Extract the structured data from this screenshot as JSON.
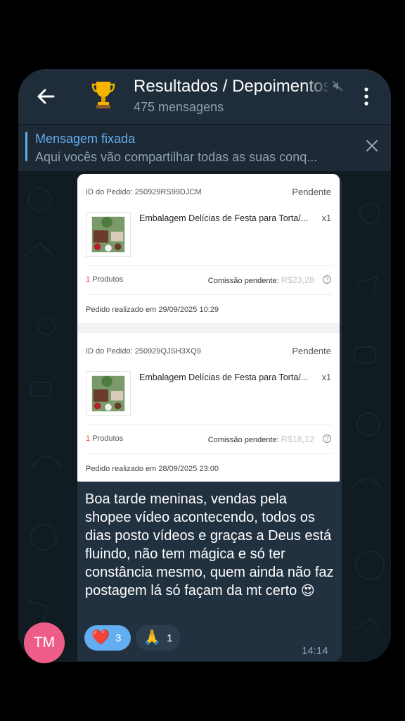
{
  "header": {
    "title": "Resultados / Depoimentos",
    "subtitle": "475 mensagens"
  },
  "pinned": {
    "label": "Mensagem fixada",
    "text": "Aqui vocês vão compartilhar todas as suas conq..."
  },
  "orders": [
    {
      "order_id": "ID do Pedido: 250929RS99DJCM",
      "status": "Pendente",
      "product": "Embalagem Delícias de Festa para Torta/...",
      "qty": "x1",
      "count_num": "1",
      "count_label": "Produtos",
      "commission_label": "Comissão pendente:",
      "commission_value": "R$23,28",
      "date": "Pedido realizado em 29/09/2025 10:29"
    },
    {
      "order_id": "ID do Pedido: 250929QJSH3XQ9",
      "status": "Pendente",
      "product": "Embalagem Delícias de Festa para Torta/...",
      "qty": "x1",
      "count_num": "1",
      "count_label": "Produtos",
      "commission_label": "Comissão pendente:",
      "commission_value": "R$18,12",
      "date": "Pedido realizado em 28/09/2025 23:00"
    }
  ],
  "message": {
    "text": "Boa tarde meninas, vendas pela shopee vídeo acontecendo, todos os dias posto  vídeos e graças a Deus está fluindo, não tem mágica e só ter constância mesmo, quem ainda não faz postagem lá só façam da mt certo",
    "emoji": "😍",
    "time": "14:14"
  },
  "reactions": [
    {
      "emoji": "❤️",
      "count": "3"
    },
    {
      "emoji": "🙏",
      "count": "1"
    }
  ],
  "avatar": {
    "initials": "TM"
  },
  "colors": {
    "accent": "#62aef0",
    "header_bg": "#1f2d3a",
    "bubble_bg": "#223140",
    "avatar_bg": "#ee5d88",
    "shopee_orange": "#e0522e"
  }
}
